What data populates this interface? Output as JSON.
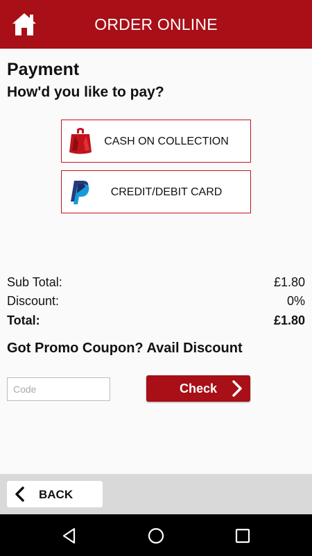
{
  "header": {
    "title": "ORDER ONLINE",
    "home_icon": "home-icon",
    "bg_color": "#a80f17"
  },
  "page": {
    "title": "Payment",
    "subtitle": "How'd you like to pay?"
  },
  "payment_options": [
    {
      "label": "CASH ON COLLECTION",
      "icon": "bag-icon"
    },
    {
      "label": "CREDIT/DEBIT CARD",
      "icon": "paypal-icon"
    }
  ],
  "summary": {
    "subtotal_label": "Sub Total:",
    "subtotal_value": "£1.80",
    "discount_label": "Discount:",
    "discount_value": "0%",
    "total_label": "Total:",
    "total_value": "£1.80"
  },
  "promo": {
    "heading": "Got Promo Coupon? Avail Discount",
    "input_placeholder": "Code",
    "input_value": "",
    "check_label": "Check"
  },
  "footer": {
    "back_label": "BACK"
  },
  "system_nav": {
    "icons": [
      "nav-back-icon",
      "nav-home-icon",
      "nav-recents-icon"
    ]
  },
  "colors": {
    "accent": "#a80f17",
    "border_accent": "#c0141c",
    "bottom_bar": "#d9d9d9"
  }
}
